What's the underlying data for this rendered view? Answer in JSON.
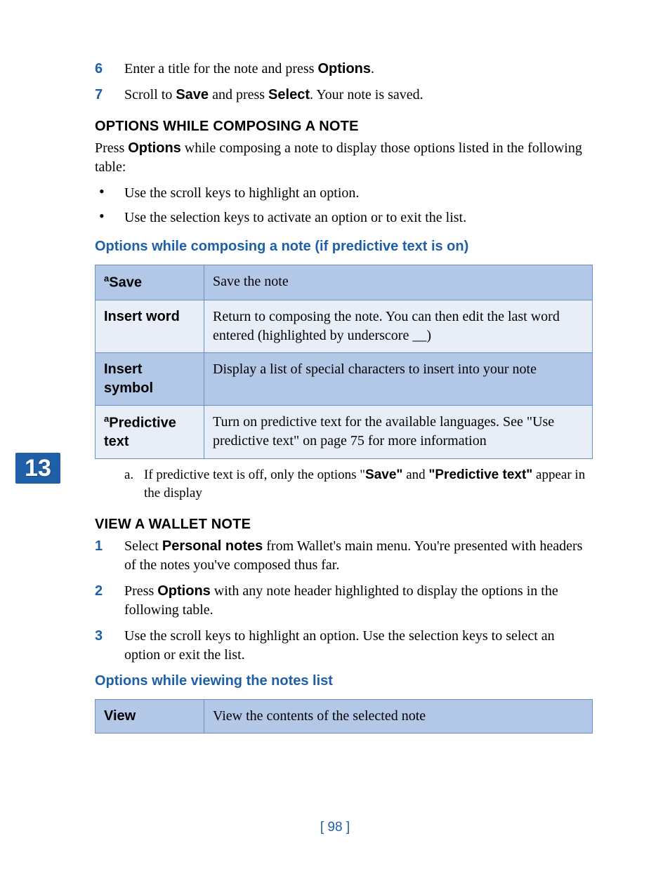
{
  "chapterNumber": "13",
  "steps_top": [
    {
      "n": "6",
      "pre": "Enter a title for the note and press ",
      "b1": "Options",
      "post": "."
    },
    {
      "n": "7",
      "pre": "Scroll to ",
      "b1": "Save",
      "mid": " and press ",
      "b2": "Select",
      "post": ". Your note is saved."
    }
  ],
  "sec1_title": "OPTIONS WHILE COMPOSING A NOTE",
  "sec1_para_pre": "Press ",
  "sec1_para_b": "Options",
  "sec1_para_post": " while composing a note to display those options listed in the following table:",
  "bullets1": [
    "Use the scroll keys to highlight an option.",
    "Use the selection keys to activate an option or to exit the list."
  ],
  "table1_title": "Options while composing a note (if predictive text is on)",
  "table1": [
    {
      "sup": "a",
      "label": "Save",
      "desc": "Save the note",
      "shade": "dark"
    },
    {
      "sup": "",
      "label": "Insert word",
      "desc": "Return to composing the note. You can then edit the last word entered (highlighted by underscore __)",
      "shade": "light"
    },
    {
      "sup": "",
      "label": "Insert symbol",
      "desc": "Display a list of special characters to insert into your note",
      "shade": "dark"
    },
    {
      "sup": "a",
      "label": "Predictive text",
      "desc": "Turn on predictive text for the available languages. See \"Use predictive text\" on page 75 for more information",
      "shade": "light"
    }
  ],
  "footnote_mark": "a.",
  "footnote_pre": "If predictive text is off, only the options \"",
  "footnote_b1": "Save\"",
  "footnote_mid": " and ",
  "footnote_b2": "\"Predictive text\"",
  "footnote_post": " appear in the display",
  "sec2_title": "VIEW A WALLET NOTE",
  "steps2": [
    {
      "n": "1",
      "pre": "Select ",
      "b1": "Personal notes",
      "post": " from Wallet's main menu. You're presented with headers of the notes you've composed thus far."
    },
    {
      "n": "2",
      "pre": "Press ",
      "b1": "Options",
      "post": " with any note header highlighted to display the options in the following table."
    },
    {
      "n": "3",
      "pre": "",
      "b1": "",
      "post": "Use the scroll keys to highlight an option. Use the selection keys to select an option or exit the list."
    }
  ],
  "table2_title": "Options while viewing the notes list",
  "table2": [
    {
      "label": "View",
      "desc": "View the contents of the selected note",
      "shade": "dark"
    }
  ],
  "pageNumber": "[ 98 ]"
}
